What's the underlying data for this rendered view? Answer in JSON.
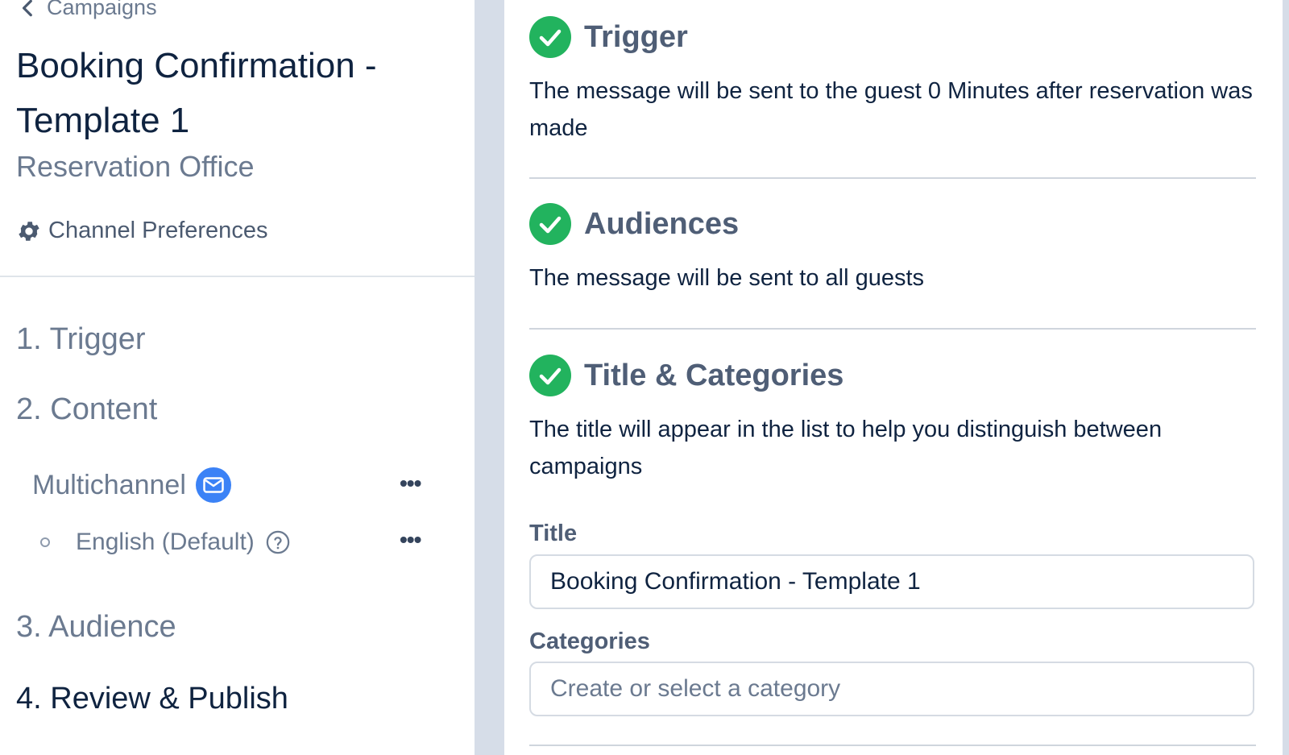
{
  "sidebar": {
    "back_label": "Campaigns",
    "page_title": "Booking Confirmation - Template 1",
    "subtitle": "Reservation Office",
    "channel_preferences": "Channel Preferences",
    "steps": [
      {
        "label": "1. Trigger"
      },
      {
        "label": "2. Content"
      },
      {
        "label": "3. Audience"
      },
      {
        "label": "4. Review & Publish"
      }
    ],
    "content_items": {
      "channel": "Multichannel",
      "language": "English (Default)",
      "more_label": "•••"
    }
  },
  "main": {
    "trigger": {
      "title": "Trigger",
      "text": "The message will be sent to the guest 0 Minutes after reservation was made"
    },
    "audiences": {
      "title": "Audiences",
      "text": "The message will be sent to all guests"
    },
    "title_categories": {
      "title": "Title & Categories",
      "text": "The title will appear in the list to help you distinguish between campaigns",
      "title_label": "Title",
      "title_value": "Booking Confirmation - Template 1",
      "categories_label": "Categories",
      "categories_placeholder": "Create or select a category"
    }
  },
  "colors": {
    "success": "#22b35e",
    "accent": "#3b82f6",
    "heading": "#0f2340",
    "muted": "#6b7a90",
    "gutter": "#d6dde8"
  }
}
